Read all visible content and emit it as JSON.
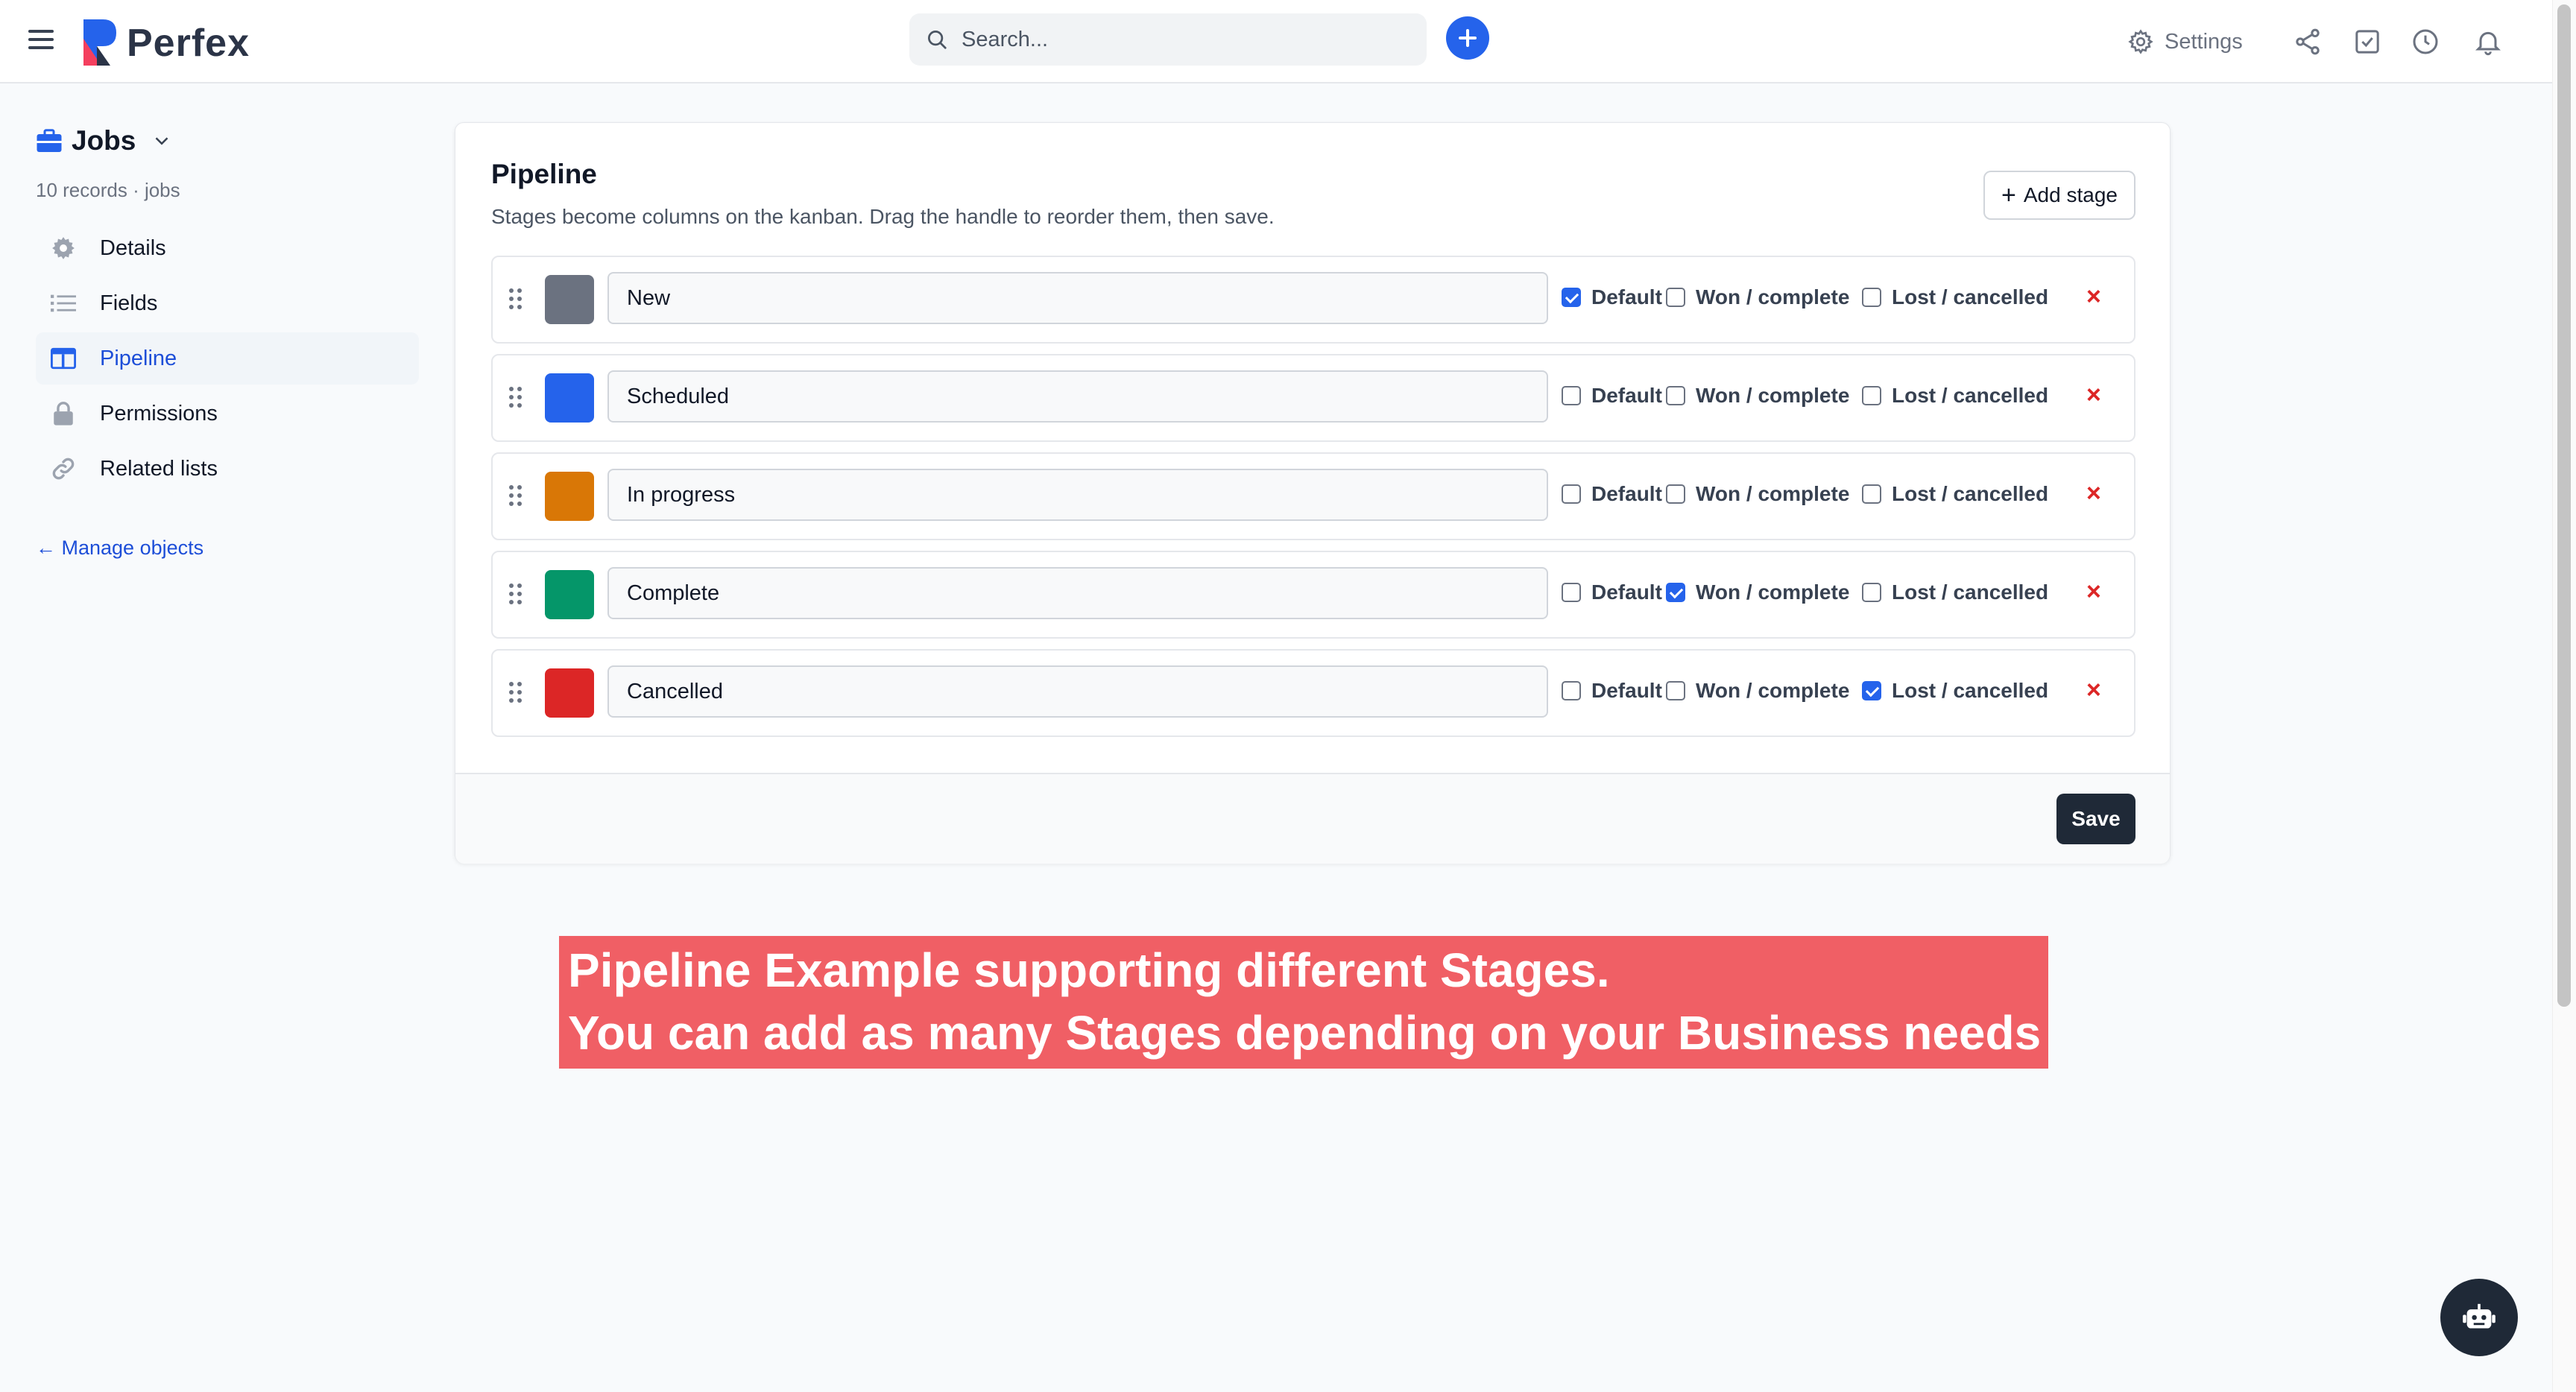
{
  "app": {
    "name": "Perfex"
  },
  "topbar": {
    "search_placeholder": "Search...",
    "settings_label": "Settings",
    "icons": [
      "menu-icon",
      "search-icon",
      "plus-icon",
      "gear-icon",
      "share-icon",
      "task-check-icon",
      "clock-icon",
      "bell-icon"
    ]
  },
  "object": {
    "title": "Jobs",
    "subtitle": "10 records · jobs",
    "icon": "briefcase-icon"
  },
  "sidebar": {
    "items": [
      {
        "label": "Details",
        "icon": "gear-icon",
        "active": false
      },
      {
        "label": "Fields",
        "icon": "list-icon",
        "active": false
      },
      {
        "label": "Pipeline",
        "icon": "board-icon",
        "active": true
      },
      {
        "label": "Permissions",
        "icon": "lock-icon",
        "active": false
      },
      {
        "label": "Related lists",
        "icon": "link-icon",
        "active": false
      }
    ],
    "manage_link": "← Manage objects"
  },
  "pipeline": {
    "title": "Pipeline",
    "description": "Stages become columns on the kanban. Drag the handle to reorder them, then save.",
    "add_stage_label": "Add stage",
    "flag_labels": {
      "default": "Default",
      "won": "Won / complete",
      "lost": "Lost / cancelled"
    },
    "stages": [
      {
        "name": "New",
        "color": "#6b7280",
        "default": true,
        "won": false,
        "lost": false
      },
      {
        "name": "Scheduled",
        "color": "#2563eb",
        "default": false,
        "won": false,
        "lost": false
      },
      {
        "name": "In progress",
        "color": "#d97706",
        "default": false,
        "won": false,
        "lost": false
      },
      {
        "name": "Complete",
        "color": "#059669",
        "default": false,
        "won": true,
        "lost": false
      },
      {
        "name": "Cancelled",
        "color": "#dc2626",
        "default": false,
        "won": false,
        "lost": true
      }
    ],
    "remove_symbol": "×",
    "save_label": "Save"
  },
  "annotation": {
    "line1": "Pipeline Example supporting different Stages.",
    "line2": "You can add as many Stages depending on your Business needs"
  },
  "colors": {
    "accent": "#2563eb",
    "banner": "#f05f65",
    "danger": "#dc2626",
    "dark": "#1f2937"
  }
}
